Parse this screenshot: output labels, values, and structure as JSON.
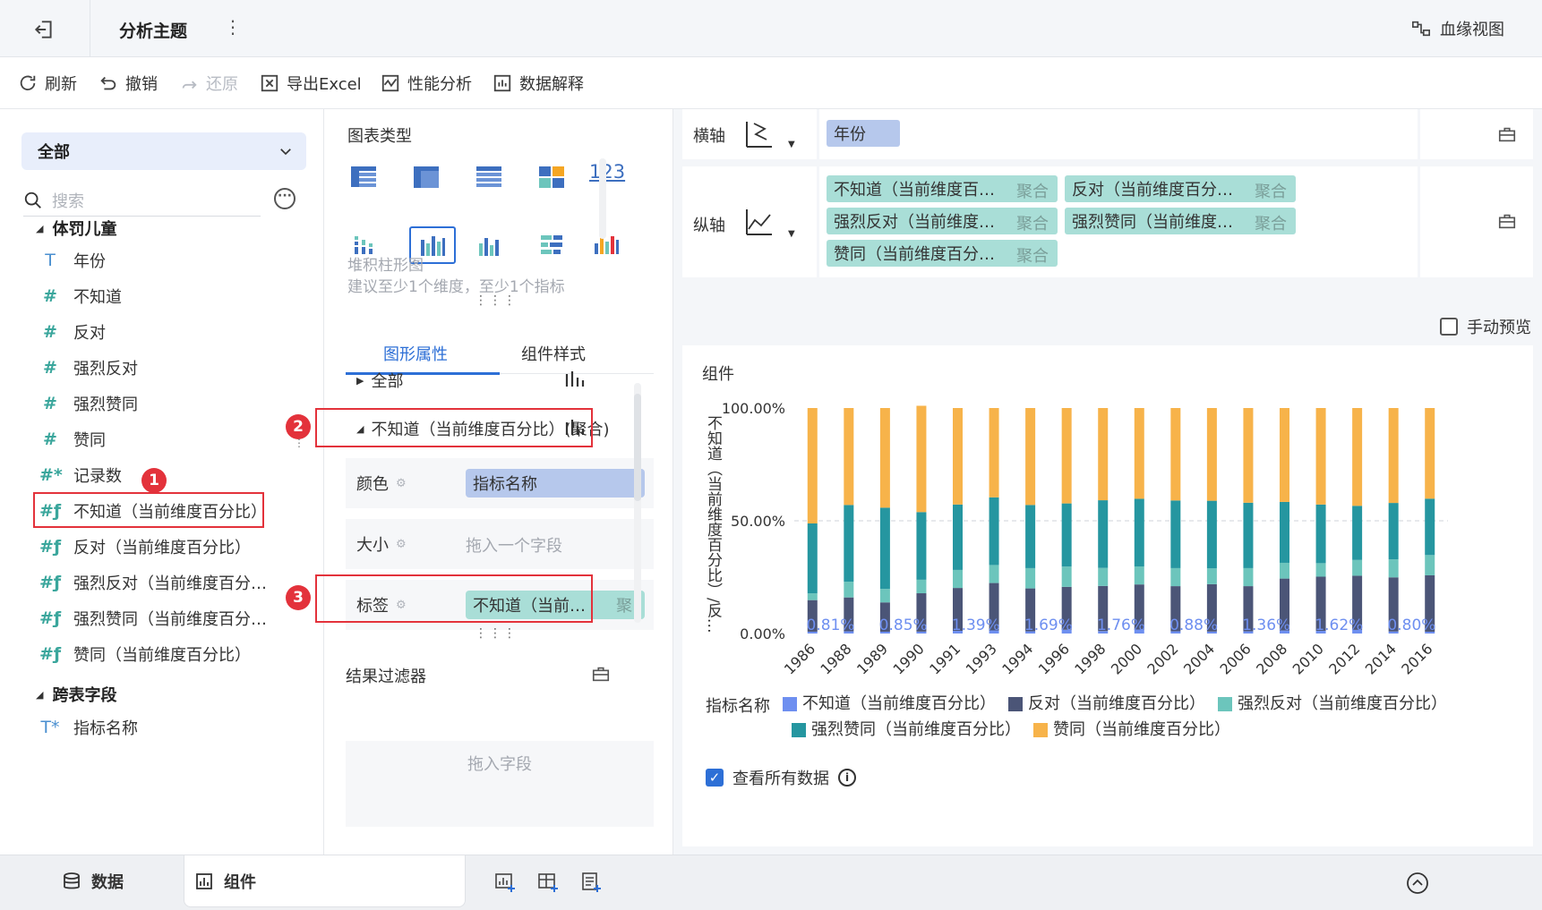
{
  "app": {
    "title": "分析主题",
    "lineage_label": "血缘视图"
  },
  "toolbar": {
    "refresh": "刷新",
    "undo": "撤销",
    "redo": "还原",
    "export": "导出Excel",
    "perf": "性能分析",
    "explain": "数据解释"
  },
  "left": {
    "scope": "全部",
    "search_placeholder": "搜索",
    "group1": "体罚儿童",
    "fields": [
      "年份",
      "不知道",
      "反对",
      "强烈反对",
      "强烈赞同",
      "赞同",
      "记录数",
      "不知道（当前维度百分比）",
      "反对（当前维度百分比）",
      "强烈反对（当前维度百分…",
      "强烈赞同（当前维度百分…",
      "赞同（当前维度百分比）"
    ],
    "group2": "跨表字段",
    "cross_field": "指标名称",
    "badge1": "1"
  },
  "mid": {
    "chart_type_title": "图表类型",
    "num_icon": "123",
    "selected_name": "堆积柱形图",
    "selected_hint": "建议至少1个维度，至少1个指标",
    "tab_props": "图形属性",
    "tab_style": "组件样式",
    "all_label": "全部",
    "series_label": "不知道（当前维度百分比）(聚合)",
    "badge2": "2",
    "color_label": "颜色",
    "color_value": "指标名称",
    "size_label": "大小",
    "size_placeholder": "拖入一个字段",
    "label_label": "标签",
    "label_value": "不知道（当前…",
    "label_agg": "聚",
    "badge3": "3",
    "filter_title": "结果过滤器",
    "filter_placeholder": "拖入字段"
  },
  "right": {
    "x_axis_label": "横轴",
    "x_field": "年份",
    "y_axis_label": "纵轴",
    "y_fields": [
      {
        "name": "不知道（当前维度百…",
        "agg": "聚合"
      },
      {
        "name": "反对（当前维度百分…",
        "agg": "聚合"
      },
      {
        "name": "强烈反对（当前维度…",
        "agg": "聚合"
      },
      {
        "name": "强烈赞同（当前维度…",
        "agg": "聚合"
      },
      {
        "name": "赞同（当前维度百分…",
        "agg": "聚合"
      }
    ],
    "manual_preview": "手动预览",
    "component_title": "组件",
    "legend_title": "指标名称",
    "view_all": "查看所有数据"
  },
  "colors": {
    "s1": "#6e8ff0",
    "s2": "#4b5577",
    "s3": "#6cc5bc",
    "s4": "#2596a0",
    "s5": "#f7b34a"
  },
  "chart_data": {
    "type": "bar",
    "stacked": true,
    "ylabel": "不知道（当前维度百分比）/反…",
    "yticks": [
      "100.00%",
      "50.00%",
      "0.00%"
    ],
    "ylim": [
      0,
      100
    ],
    "categories": [
      "1986",
      "1988",
      "1989",
      "1990",
      "1991",
      "1993",
      "1994",
      "1996",
      "1998",
      "2000",
      "2002",
      "2004",
      "2006",
      "2008",
      "2010",
      "2012",
      "2014",
      "2016"
    ],
    "series": [
      {
        "name": "不知道（当前维度百分比）",
        "values": [
          0.81,
          1.0,
          0.8,
          0.85,
          1.2,
          1.39,
          1.0,
          1.69,
          1.1,
          1.76,
          1.0,
          0.88,
          1.0,
          1.36,
          1.2,
          1.62,
          0.9,
          0.8
        ]
      },
      {
        "name": "反对（当前维度百分比）",
        "values": [
          14,
          15,
          13,
          17,
          19,
          21,
          19,
          19,
          20,
          20,
          20,
          21,
          20,
          23,
          24,
          24,
          24,
          25
        ]
      },
      {
        "name": "强烈反对（当前维度百分比）",
        "values": [
          3,
          7,
          6,
          6,
          8,
          8,
          9,
          9,
          8,
          8,
          8,
          7,
          8,
          7,
          6,
          7,
          8,
          9
        ]
      },
      {
        "name": "强烈赞同（当前维度百分比）",
        "values": [
          31,
          34,
          36,
          30,
          29,
          30,
          28,
          28,
          30,
          30,
          30,
          30,
          29,
          27,
          26,
          24,
          25,
          25
        ]
      },
      {
        "name": "赞同（当前维度百分比）",
        "values": [
          51.19,
          43.0,
          44.2,
          47.15,
          42.8,
          39.61,
          43.0,
          42.31,
          40.9,
          40.24,
          41.0,
          41.12,
          42.0,
          41.64,
          42.8,
          43.38,
          42.1,
          40.2
        ]
      }
    ],
    "data_labels": [
      "0.81%",
      "0.85%",
      "1.39%",
      "1.69%",
      "1.76%",
      "0.88%",
      "1.36%",
      "1.62%",
      "0.80%"
    ],
    "data_label_index": [
      0,
      2,
      4,
      6,
      8,
      10,
      12,
      14,
      16
    ]
  },
  "bottom": {
    "data_tab": "数据",
    "component_tab": "组件"
  }
}
